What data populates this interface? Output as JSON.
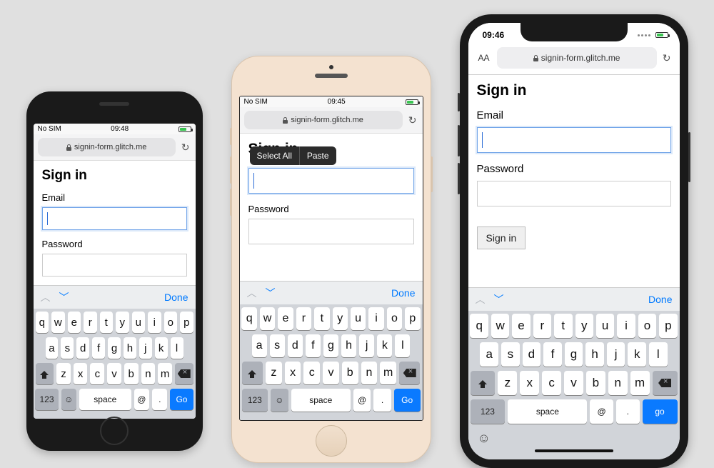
{
  "url": "signin-form.glitch.me",
  "page": {
    "heading": "Sign in",
    "email_label": "Email",
    "password_label": "Password",
    "signin_button": "Sign in"
  },
  "statusbar": {
    "phone1_left": "No SIM",
    "phone1_time": "09:48",
    "phone2_left": "No SIM",
    "phone2_time": "09:45",
    "phone3_time": "09:46"
  },
  "addressbar": {
    "aa": "AA"
  },
  "context_menu": {
    "select_all": "Select All",
    "paste": "Paste"
  },
  "keyboard": {
    "done": "Done",
    "row1": [
      "q",
      "w",
      "e",
      "r",
      "t",
      "y",
      "u",
      "i",
      "o",
      "p"
    ],
    "row2": [
      "a",
      "s",
      "d",
      "f",
      "g",
      "h",
      "j",
      "k",
      "l"
    ],
    "row3": [
      "z",
      "x",
      "c",
      "v",
      "b",
      "n",
      "m"
    ],
    "k123": "123",
    "space": "space",
    "at": "@",
    "dot": ".",
    "go": "Go",
    "go_lc": "go"
  }
}
